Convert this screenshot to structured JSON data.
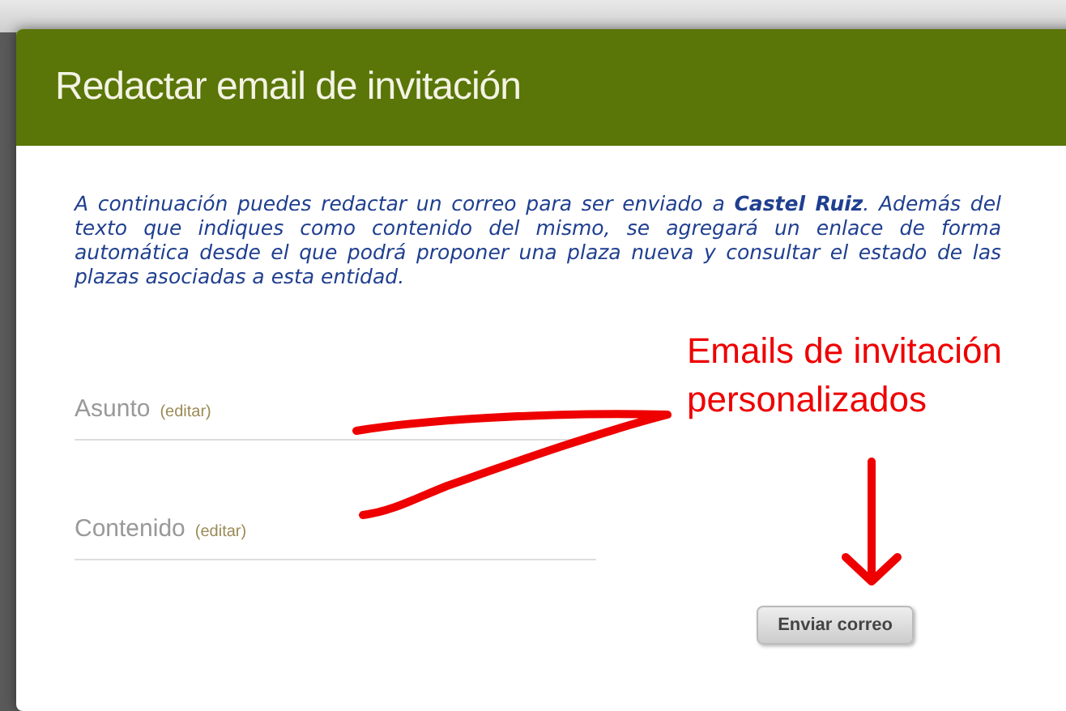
{
  "dialog": {
    "title": "Redactar email de invitación",
    "intro": "A continuación puedes redactar un correo para ser enviado a **Castel Ruiz**. Además del texto que indiques como contenido del mismo, se agregará un enlace de forma automática desde el que podrá proponer una plaza nueva y consultar el estado de las plazas asociadas a esta entidad.",
    "fields": [
      {
        "label": "Asunto",
        "edit_link": "(editar)"
      },
      {
        "label": "Contenido",
        "edit_link": "(editar)"
      }
    ],
    "button": "Enviar correo"
  },
  "annotation": {
    "text": "Emails de invitación personalizados"
  }
}
